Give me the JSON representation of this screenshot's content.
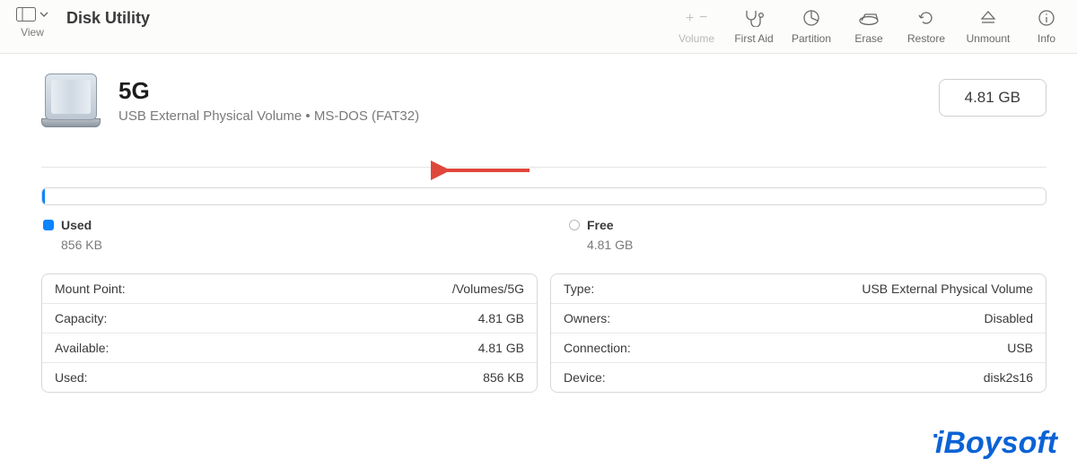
{
  "toolbar": {
    "view_label": "View",
    "title": "Disk Utility",
    "actions": {
      "volume": "Volume",
      "first_aid": "First Aid",
      "partition": "Partition",
      "erase": "Erase",
      "restore": "Restore",
      "unmount": "Unmount",
      "info": "Info"
    }
  },
  "volume": {
    "name": "5G",
    "subtitle": "USB External Physical Volume • MS-DOS (FAT32)",
    "size_display": "4.81 GB"
  },
  "usage": {
    "used_label": "Used",
    "used_value": "856 KB",
    "free_label": "Free",
    "free_value": "4.81 GB"
  },
  "details_left": [
    {
      "k": "Mount Point:",
      "v": "/Volumes/5G"
    },
    {
      "k": "Capacity:",
      "v": "4.81 GB"
    },
    {
      "k": "Available:",
      "v": "4.81 GB"
    },
    {
      "k": "Used:",
      "v": "856 KB"
    }
  ],
  "details_right": [
    {
      "k": "Type:",
      "v": "USB External Physical Volume"
    },
    {
      "k": "Owners:",
      "v": "Disabled"
    },
    {
      "k": "Connection:",
      "v": "USB"
    },
    {
      "k": "Device:",
      "v": "disk2s16"
    }
  ],
  "watermark": "iBoysoft"
}
